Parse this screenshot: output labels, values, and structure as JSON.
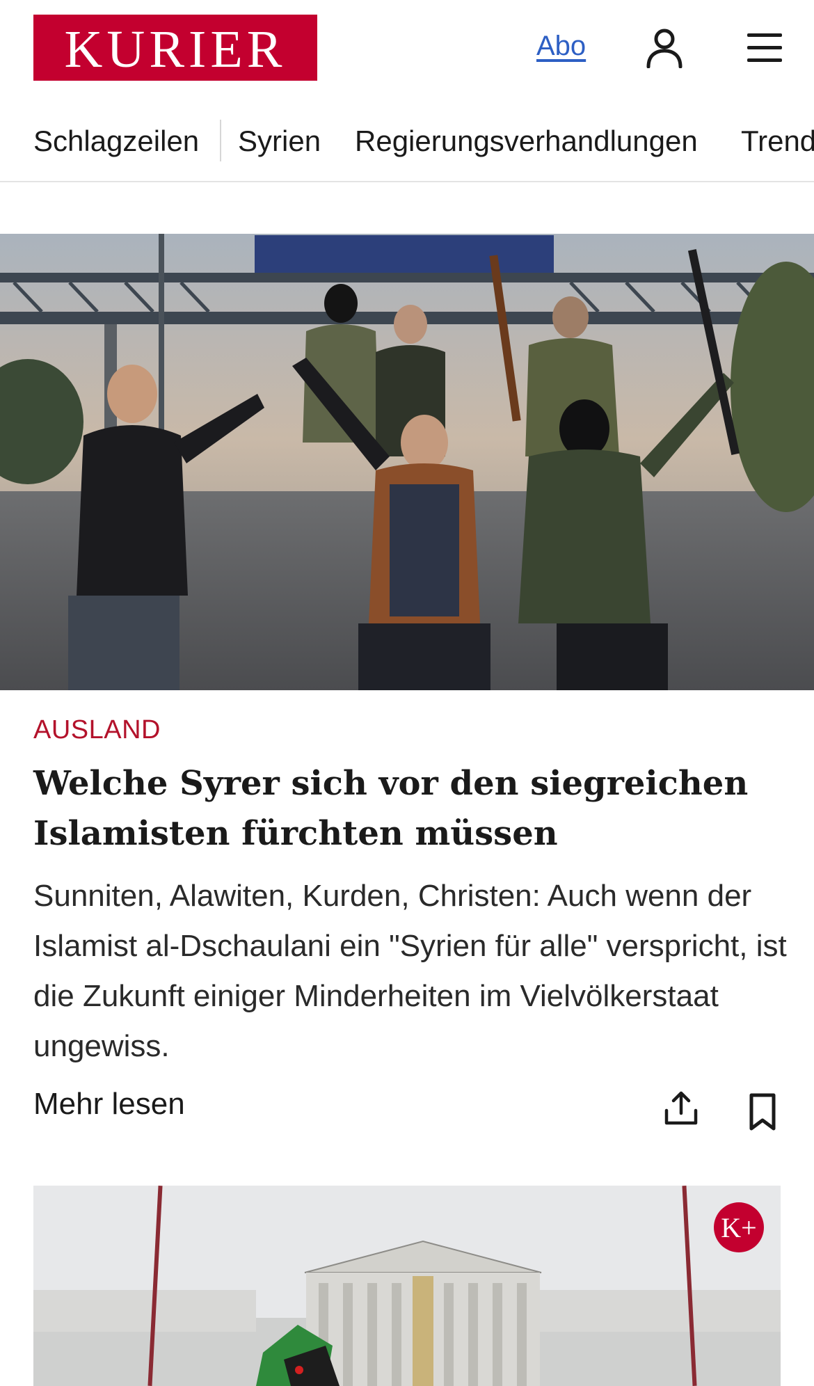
{
  "header": {
    "logo_text": "KURIER",
    "abo_label": "Abo",
    "icons": [
      "user-icon",
      "menu-icon"
    ]
  },
  "nav": {
    "items": [
      "Schlagzeilen",
      "Syrien",
      "Regierungsverhandlungen",
      "Trend"
    ]
  },
  "article": {
    "image_alt": "Gruppe bewaffneter Männer zeigt Victory-Zeichen auf einer Straße",
    "category": "AUSLAND",
    "headline": "Welche Syrer sich vor den siegreichen Is­lamisten fürchten müssen",
    "teaser": "Sunniten, Alawiten, Kurden, Christen: Auch wenn der Islamist al-Dschaulani ein \"Syrien für alle\" verspricht, ist die Zukunft einiger Minderheiten im Vielvölkerstaat ungewiss.",
    "more_label": "Mehr lesen",
    "icons": [
      "share-icon",
      "bookmark-icon"
    ]
  },
  "card2": {
    "badge": "K+",
    "image_alt": "Parlament in Wien mit syrischer Oppositionsflagge"
  },
  "colors": {
    "brand": "#c3002f",
    "category": "#b3122b",
    "link": "#2d5fc4"
  }
}
